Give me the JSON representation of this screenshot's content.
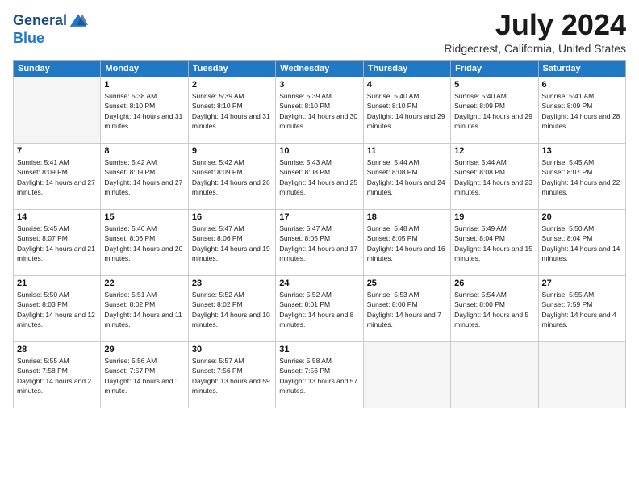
{
  "header": {
    "logo_line1": "General",
    "logo_line2": "Blue",
    "month": "July 2024",
    "location": "Ridgecrest, California, United States"
  },
  "weekdays": [
    "Sunday",
    "Monday",
    "Tuesday",
    "Wednesday",
    "Thursday",
    "Friday",
    "Saturday"
  ],
  "weeks": [
    [
      {
        "day": "",
        "empty": true
      },
      {
        "day": "1",
        "sunrise": "5:38 AM",
        "sunset": "8:10 PM",
        "daylight": "14 hours and 31 minutes."
      },
      {
        "day": "2",
        "sunrise": "5:39 AM",
        "sunset": "8:10 PM",
        "daylight": "14 hours and 31 minutes."
      },
      {
        "day": "3",
        "sunrise": "5:39 AM",
        "sunset": "8:10 PM",
        "daylight": "14 hours and 30 minutes."
      },
      {
        "day": "4",
        "sunrise": "5:40 AM",
        "sunset": "8:10 PM",
        "daylight": "14 hours and 29 minutes."
      },
      {
        "day": "5",
        "sunrise": "5:40 AM",
        "sunset": "8:09 PM",
        "daylight": "14 hours and 29 minutes."
      },
      {
        "day": "6",
        "sunrise": "5:41 AM",
        "sunset": "8:09 PM",
        "daylight": "14 hours and 28 minutes."
      }
    ],
    [
      {
        "day": "7",
        "sunrise": "5:41 AM",
        "sunset": "8:09 PM",
        "daylight": "14 hours and 27 minutes."
      },
      {
        "day": "8",
        "sunrise": "5:42 AM",
        "sunset": "8:09 PM",
        "daylight": "14 hours and 27 minutes."
      },
      {
        "day": "9",
        "sunrise": "5:42 AM",
        "sunset": "8:09 PM",
        "daylight": "14 hours and 26 minutes."
      },
      {
        "day": "10",
        "sunrise": "5:43 AM",
        "sunset": "8:08 PM",
        "daylight": "14 hours and 25 minutes."
      },
      {
        "day": "11",
        "sunrise": "5:44 AM",
        "sunset": "8:08 PM",
        "daylight": "14 hours and 24 minutes."
      },
      {
        "day": "12",
        "sunrise": "5:44 AM",
        "sunset": "8:08 PM",
        "daylight": "14 hours and 23 minutes."
      },
      {
        "day": "13",
        "sunrise": "5:45 AM",
        "sunset": "8:07 PM",
        "daylight": "14 hours and 22 minutes."
      }
    ],
    [
      {
        "day": "14",
        "sunrise": "5:45 AM",
        "sunset": "8:07 PM",
        "daylight": "14 hours and 21 minutes."
      },
      {
        "day": "15",
        "sunrise": "5:46 AM",
        "sunset": "8:06 PM",
        "daylight": "14 hours and 20 minutes."
      },
      {
        "day": "16",
        "sunrise": "5:47 AM",
        "sunset": "8:06 PM",
        "daylight": "14 hours and 19 minutes."
      },
      {
        "day": "17",
        "sunrise": "5:47 AM",
        "sunset": "8:05 PM",
        "daylight": "14 hours and 17 minutes."
      },
      {
        "day": "18",
        "sunrise": "5:48 AM",
        "sunset": "8:05 PM",
        "daylight": "14 hours and 16 minutes."
      },
      {
        "day": "19",
        "sunrise": "5:49 AM",
        "sunset": "8:04 PM",
        "daylight": "14 hours and 15 minutes."
      },
      {
        "day": "20",
        "sunrise": "5:50 AM",
        "sunset": "8:04 PM",
        "daylight": "14 hours and 14 minutes."
      }
    ],
    [
      {
        "day": "21",
        "sunrise": "5:50 AM",
        "sunset": "8:03 PM",
        "daylight": "14 hours and 12 minutes."
      },
      {
        "day": "22",
        "sunrise": "5:51 AM",
        "sunset": "8:02 PM",
        "daylight": "14 hours and 11 minutes."
      },
      {
        "day": "23",
        "sunrise": "5:52 AM",
        "sunset": "8:02 PM",
        "daylight": "14 hours and 10 minutes."
      },
      {
        "day": "24",
        "sunrise": "5:52 AM",
        "sunset": "8:01 PM",
        "daylight": "14 hours and 8 minutes."
      },
      {
        "day": "25",
        "sunrise": "5:53 AM",
        "sunset": "8:00 PM",
        "daylight": "14 hours and 7 minutes."
      },
      {
        "day": "26",
        "sunrise": "5:54 AM",
        "sunset": "8:00 PM",
        "daylight": "14 hours and 5 minutes."
      },
      {
        "day": "27",
        "sunrise": "5:55 AM",
        "sunset": "7:59 PM",
        "daylight": "14 hours and 4 minutes."
      }
    ],
    [
      {
        "day": "28",
        "sunrise": "5:55 AM",
        "sunset": "7:58 PM",
        "daylight": "14 hours and 2 minutes."
      },
      {
        "day": "29",
        "sunrise": "5:56 AM",
        "sunset": "7:57 PM",
        "daylight": "14 hours and 1 minute."
      },
      {
        "day": "30",
        "sunrise": "5:57 AM",
        "sunset": "7:56 PM",
        "daylight": "13 hours and 59 minutes."
      },
      {
        "day": "31",
        "sunrise": "5:58 AM",
        "sunset": "7:56 PM",
        "daylight": "13 hours and 57 minutes."
      },
      {
        "day": "",
        "empty": true
      },
      {
        "day": "",
        "empty": true
      },
      {
        "day": "",
        "empty": true
      }
    ]
  ]
}
